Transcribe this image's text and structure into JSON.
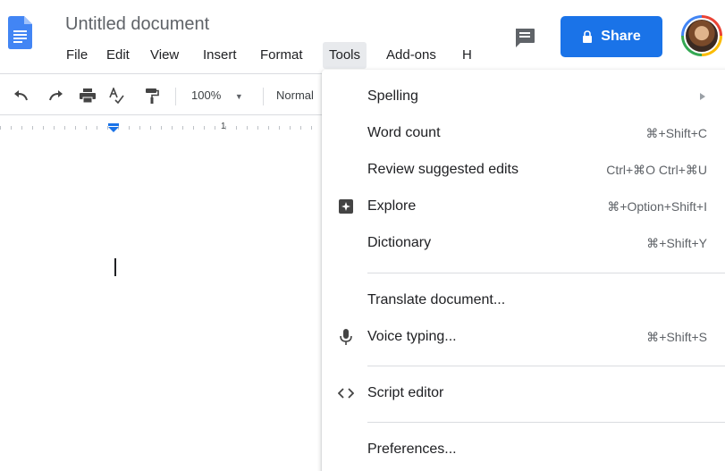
{
  "doc": {
    "title": "Untitled document"
  },
  "menubar": {
    "items": [
      "File",
      "Edit",
      "View",
      "Insert",
      "Format",
      "Tools",
      "Add-ons",
      "H"
    ],
    "active": "Tools"
  },
  "header": {
    "share_label": "Share",
    "comment_icon": "comment-icon",
    "avatar_icon": "account-avatar"
  },
  "toolbar": {
    "zoom": "100%",
    "paragraph_style": "Normal",
    "icons": [
      "undo-icon",
      "redo-icon",
      "print-icon",
      "spellcheck-icon",
      "paint-format-icon"
    ]
  },
  "ruler": {
    "label": "1"
  },
  "tools_menu": {
    "items": [
      {
        "label": "Spelling",
        "shortcut": "",
        "icon": "",
        "submenu": true
      },
      {
        "label": "Word count",
        "shortcut": "⌘+Shift+C",
        "icon": ""
      },
      {
        "label": "Review suggested edits",
        "shortcut": "Ctrl+⌘O Ctrl+⌘U",
        "icon": ""
      },
      {
        "label": "Explore",
        "shortcut": "⌘+Option+Shift+I",
        "icon": "explore-icon"
      },
      {
        "label": "Dictionary",
        "shortcut": "⌘+Shift+Y",
        "icon": ""
      },
      {
        "label": "Translate document...",
        "shortcut": "",
        "icon": ""
      },
      {
        "label": "Voice typing...",
        "shortcut": "⌘+Shift+S",
        "icon": "microphone-icon"
      },
      {
        "label": "Script editor",
        "shortcut": "",
        "icon": "code-icon"
      },
      {
        "label": "Preferences...",
        "shortcut": "",
        "icon": ""
      }
    ]
  },
  "colors": {
    "accent": "#1a73e8",
    "menu_active_bg": "#e8eaed",
    "docs_blue": "#4285f4"
  }
}
